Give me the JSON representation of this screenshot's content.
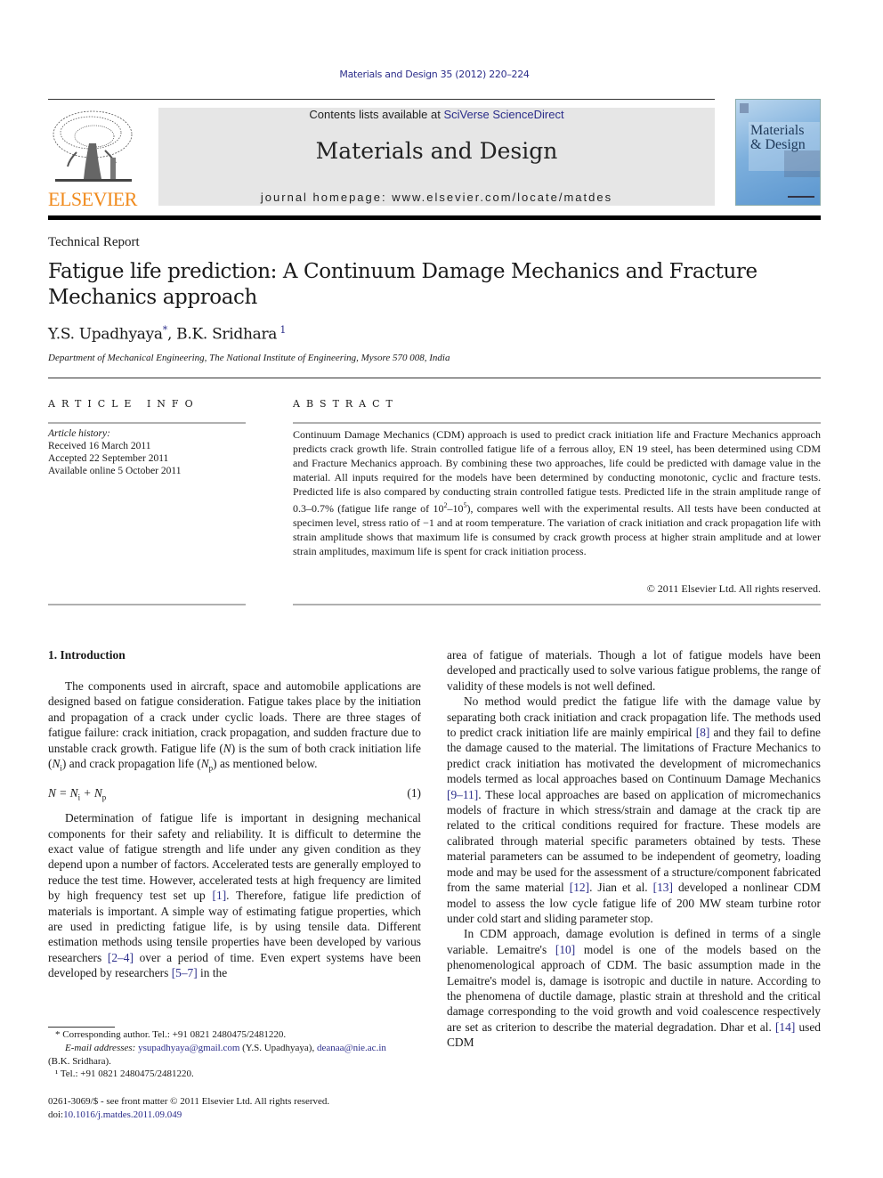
{
  "header": {
    "journal_ref": "Materials and Design 35 (2012) 220–224",
    "contents_prefix": "Contents lists available at ",
    "contents_link": "SciVerse ScienceDirect",
    "journal_title": "Materials and Design",
    "homepage": "journal homepage: www.elsevier.com/locate/matdes",
    "publisher_logo_text": "ELSEVIER",
    "cover_title_line1": "Materials",
    "cover_title_line2": "& Design",
    "colors": {
      "link": "#2b2d8a",
      "elsevier_orange": "#f08a1c",
      "masthead_bg": "#e6e6e6"
    }
  },
  "article": {
    "type": "Technical Report",
    "title": "Fatigue life prediction: A Continuum Damage Mechanics and Fracture Mechanics approach",
    "authors": [
      {
        "name": "Y.S. Upadhyaya",
        "mark": "*"
      },
      {
        "name": "B.K. Sridhara",
        "mark": "1"
      }
    ],
    "author_separator": ", ",
    "affiliation": "Department of Mechanical Engineering, The National Institute of Engineering, Mysore 570 008, India"
  },
  "article_info": {
    "heading": "ARTICLE INFO",
    "history_label": "Article history:",
    "received": "Received 16 March 2011",
    "accepted": "Accepted 22 September 2011",
    "available": "Available online 5 October 2011"
  },
  "abstract": {
    "heading": "ABSTRACT",
    "text_part1": "Continuum Damage Mechanics (CDM) approach is used to predict crack initiation life and Fracture Mechanics approach predicts crack growth life. Strain controlled fatigue life of a ferrous alloy, EN 19 steel, has been determined using CDM and Fracture Mechanics approach. By combining these two approaches, life could be predicted with damage value in the material. All inputs required for the models have been determined by conducting monotonic, cyclic and fracture tests. Predicted life is also compared by conducting strain controlled fatigue tests. Predicted life in the strain amplitude range of 0.3–0.7% (fatigue life range of 10",
    "exp1": "2",
    "dash": "–10",
    "exp2": "5",
    "text_part2": "), compares well with the experimental results. All tests have been conducted at specimen level, stress ratio of −1 and at room temperature. The variation of crack initiation and crack propagation life with strain amplitude shows that maximum life is consumed by crack growth process at higher strain amplitude and at lower strain amplitudes, maximum life is spent for crack initiation process.",
    "copyright": "© 2011 Elsevier Ltd. All rights reserved."
  },
  "body": {
    "intro_heading": "1. Introduction",
    "p1_a": "The components used in aircraft, space and automobile applications are designed based on fatigue consideration. Fatigue takes place by the initiation and propagation of a crack under cyclic loads. There are three stages of fatigue failure: crack initiation, crack propagation, and sudden fracture due to unstable crack growth. Fatigue life (",
    "p1_N": "N",
    "p1_b": ") is the sum of both crack initiation life (",
    "p1_Ni": "N",
    "p1_i": "i",
    "p1_c": ") and crack propagation life (",
    "p1_Np": "N",
    "p1_p": "p",
    "p1_d": ") as mentioned below.",
    "equation": "N = N",
    "eq_sub_i": "i",
    "eq_plus": " + N",
    "eq_sub_p": "p",
    "equation_number": "(1)",
    "p2_a": "Determination of fatigue life is important in designing mechanical components for their safety and reliability. It is difficult to determine the exact value of fatigue strength and life under any given condition as they depend upon a number of factors. Accelerated tests are generally employed to reduce the test time. However, accelerated tests at high frequency are limited by high frequency test set up ",
    "ref1": "[1]",
    "p2_b": ". Therefore, fatigue life prediction of materials is important. A simple way of estimating fatigue properties, which are used in predicting fatigue life, is by using tensile data. Different estimation methods using tensile properties have been developed by various researchers ",
    "ref2_4": "[2–4]",
    "p2_c": " over a period of time. Even expert systems have been developed by researchers ",
    "ref5_7": "[5–7]",
    "p2_d": " in the area of fatigue of materials. Though a lot of fatigue models have been developed and practically used to solve various fatigue problems, the range of validity of these models is not well defined.",
    "p3_a": "No method would predict the fatigue life with the damage value by separating both crack initiation and crack propagation life. The methods used to predict crack initiation life are mainly empirical ",
    "ref8": "[8]",
    "p3_b": " and they fail to define the damage caused to the material. The limitations of Fracture Mechanics to predict crack initiation has motivated the development of micromechanics models termed as local approaches based on Continuum Damage Mechanics ",
    "ref9_11": "[9–11]",
    "p3_c": ". These local approaches are based on application of micromechanics models of fracture in which stress/strain and damage at the crack tip are related to the critical conditions required for fracture. These models are calibrated through material specific parameters obtained by tests. These material parameters can be assumed to be independent of geometry, loading mode and may be used for the assessment of a structure/component fabricated from the same material ",
    "ref12": "[12]",
    "p3_d": ". Jian et al. ",
    "ref13": "[13]",
    "p3_e": " developed a nonlinear CDM model to assess the low cycle fatigue life of 200 MW steam turbine rotor under cold start and sliding parameter stop.",
    "p4_a": "In CDM approach, damage evolution is defined in terms of a single variable. Lemaitre's ",
    "ref10": "[10]",
    "p4_b": " model is one of the models based on the phenomenological approach of CDM. The basic assumption made in the Lemaitre's model is, damage is isotropic and ductile in nature. According to the phenomena of ductile damage, plastic strain at threshold and the critical damage corresponding to the void growth and void coalescence respectively are set as criterion to describe the material degradation. Dhar et al. ",
    "ref14": "[14]",
    "p4_c": " used CDM"
  },
  "footnotes": {
    "corresponding": "* Corresponding author. Tel.: +91 0821 2480475/2481220.",
    "email_label": "E-mail addresses: ",
    "email1": "ysupadhyaya@gmail.com",
    "email1_owner": " (Y.S. Upadhyaya), ",
    "email2": "deanaa@nie.ac.in",
    "email2_owner": "(B.K. Sridhara).",
    "fn1": "¹ Tel.: +91 0821 2480475/2481220."
  },
  "front_matter": {
    "issn_line": "0261-3069/$ - see front matter © 2011 Elsevier Ltd. All rights reserved.",
    "doi_prefix": "doi:",
    "doi": "10.1016/j.matdes.2011.09.049"
  }
}
